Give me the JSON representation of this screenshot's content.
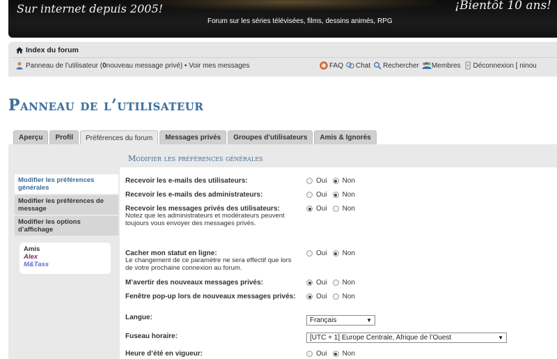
{
  "header": {
    "since_text": "Sur internet depuis 2005!",
    "soon_text": "¡Bientôt 10 ans!",
    "description": "Forum sur les séries télévisées, films, dessins animés, RPG"
  },
  "nav": {
    "home_label": "Index du forum",
    "ucp_prefix": "Panneau de l’utilisateur (",
    "pm_count": "0",
    "ucp_suffix": " nouveau message privé) • Voir mes messages",
    "links": {
      "faq": "FAQ",
      "chat": "Chat",
      "search": "Rechercher",
      "members": "Membres",
      "logout": "Déconnexion [ ninou"
    },
    "icons": [
      "home-icon",
      "user-panel-icon",
      "faq-icon",
      "chat-icon",
      "search-icon",
      "members-icon",
      "logout-icon"
    ]
  },
  "page": {
    "title": "Panneau de l’utilisateur",
    "tabs": [
      "Aperçu",
      "Profil",
      "Préférences du forum",
      "Messages privés",
      "Groupes d’utilisateurs",
      "Amis & Ignorés"
    ],
    "active_tab": "Préférences du forum"
  },
  "sidebar": {
    "items": [
      "Modifier les préférences générales",
      "Modifier les préférences de message",
      "Modifier les options d’affichage"
    ],
    "active_item": "Modifier les préférences générales",
    "friends_header": "Amis",
    "friends": [
      "Alex",
      "M&Tass"
    ]
  },
  "section": {
    "title": "Modifier les préférences générales"
  },
  "options": {
    "yes": "Oui",
    "no": "Non"
  },
  "form": {
    "rows": [
      {
        "label": "Recevoir les e-mails des utilisateurs:",
        "note": "",
        "selected": "Non"
      },
      {
        "label": "Recevoir les e-mails des administrateurs:",
        "note": "",
        "selected": "Non"
      },
      {
        "label": "Recevoir les messages privés des utilisateurs:",
        "note": "Notez que les administrateurs et modérateurs peuvent toujours vous envoyer des messages privés.",
        "selected": "Oui"
      },
      {
        "label": "Cacher mon statut en ligne:",
        "note": "Le changement de ce paramètre ne sera effectif que lors de votre prochaine connexion au forum.",
        "selected": "Non"
      },
      {
        "label": "M’avertir des nouveaux messages privés:",
        "note": "",
        "selected": "Oui"
      },
      {
        "label": "Fenêtre pop-up lors de nouveaux messages privés:",
        "note": "",
        "selected": "Oui"
      },
      {
        "label": "Langue:",
        "note": "",
        "select_value": "Français"
      },
      {
        "label": "Fuseau horaire:",
        "note": "",
        "select_value": "[UTC + 1] Europe Centrale, Afrique de l’Ouest"
      },
      {
        "label": "Heure d’été en vigueur:",
        "note": "",
        "selected": "Non"
      }
    ]
  },
  "colors": {
    "title_blue": "#3e6f9c",
    "panel_gray": "#e9e9e9",
    "friend_alex": "#7a2a78",
    "friend_mtass": "#5f6fd1"
  }
}
